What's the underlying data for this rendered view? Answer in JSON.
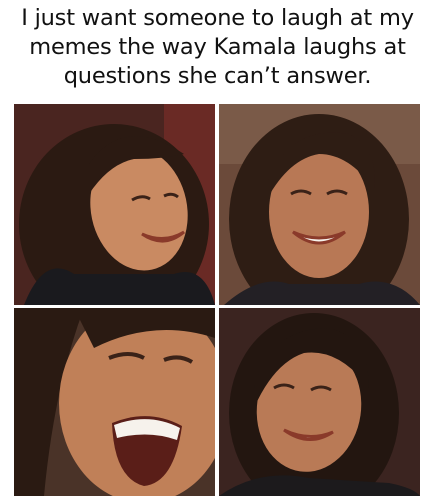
{
  "caption": {
    "line1": "I just want someone to laugh at my",
    "line2": "memes the way Kamala laughs at",
    "line3": "questions she can’t answer."
  },
  "photos": [
    {
      "name": "laughing-photo-top-left",
      "bg": "#5a2a24",
      "hair": "#2b1a12",
      "skin": "#c98a62",
      "top": "#1a1a1e"
    },
    {
      "name": "laughing-photo-top-right",
      "bg": "#6b4a3a",
      "hair": "#2e1d14",
      "skin": "#b87855",
      "top": "#232025"
    },
    {
      "name": "laughing-photo-bottom-left",
      "bg": "#4a3328",
      "hair": "#2a1a12",
      "skin": "#c08058",
      "top": "#1e1a1a"
    },
    {
      "name": "laughing-photo-bottom-right",
      "bg": "#3b2420",
      "hair": "#231610",
      "skin": "#b97a56",
      "top": "#1c1a1c"
    }
  ]
}
